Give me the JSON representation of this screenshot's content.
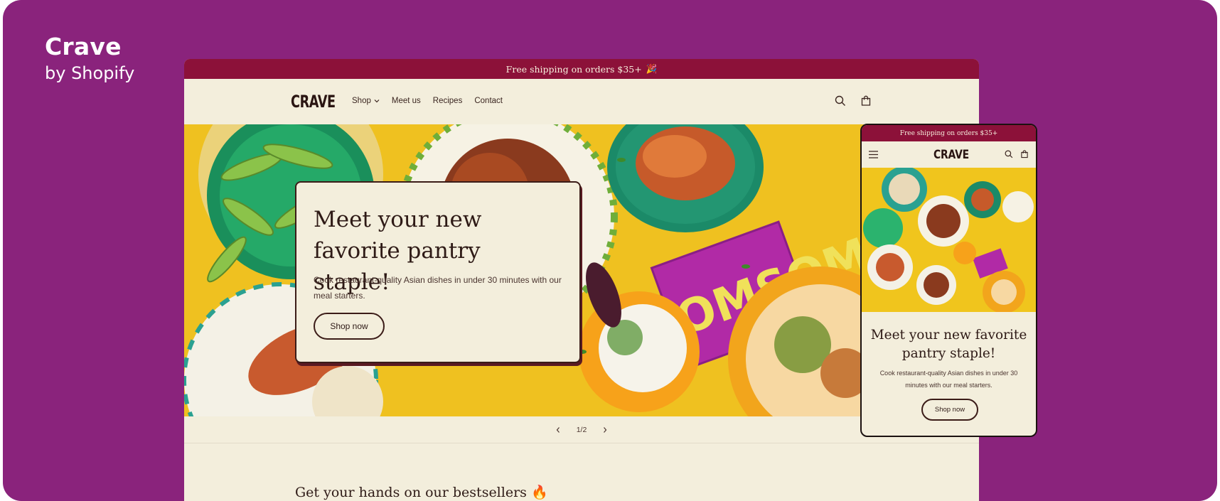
{
  "brand": {
    "name": "Crave",
    "sub": "by Shopify"
  },
  "desktop": {
    "announcement": "Free shipping on orders $35+",
    "announcement_emoji": "🎉",
    "logo": "CRAVE",
    "nav": [
      {
        "label": "Shop",
        "has_dropdown": true
      },
      {
        "label": "Meet us"
      },
      {
        "label": "Recipes"
      },
      {
        "label": "Contact"
      }
    ],
    "icons": {
      "search": "search-icon",
      "cart": "cart-icon"
    },
    "hero": {
      "title": "Meet your new favorite pantry staple!",
      "subtitle": "Cook restaurant-quality Asian dishes in under 30 minutes with our meal starters.",
      "button": "Shop now",
      "package_text": "OMSOM"
    },
    "pager": {
      "current": "1/2",
      "prev_icon": "chevron-left-icon",
      "next_icon": "chevron-right-icon"
    },
    "section_heading": "Get your hands on our bestsellers 🔥"
  },
  "mobile": {
    "announcement": "Free shipping on orders $35+",
    "logo": "CRAVE",
    "hero": {
      "title": "Meet your new favorite pantry staple!",
      "subtitle": "Cook restaurant-quality Asian dishes in under 30 minutes with our meal starters.",
      "button": "Shop now"
    }
  },
  "colors": {
    "background": "#8a237c",
    "announcement_bar": "#8c1139",
    "page": "#f3eedc",
    "hero_yellow": "#f0c51d",
    "text_dark": "#2e1a16"
  }
}
